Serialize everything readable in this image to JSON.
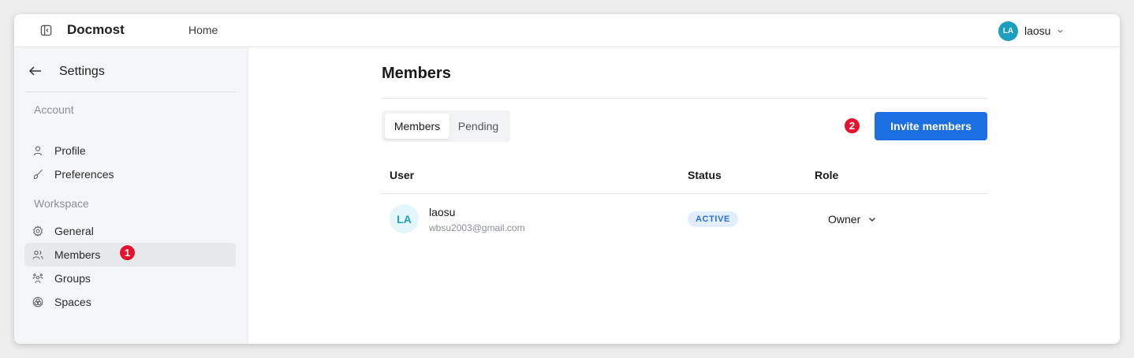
{
  "header": {
    "app_name": "Docmost",
    "home_link": "Home",
    "user": {
      "initials": "LA",
      "name": "laosu"
    }
  },
  "sidebar": {
    "title": "Settings",
    "sections": [
      {
        "label": "Account",
        "items": [
          {
            "label": "Profile",
            "icon": "user-icon"
          },
          {
            "label": "Preferences",
            "icon": "brush-icon"
          }
        ]
      },
      {
        "label": "Workspace",
        "items": [
          {
            "label": "General",
            "icon": "gear-icon"
          },
          {
            "label": "Members",
            "icon": "users-icon",
            "active": true
          },
          {
            "label": "Groups",
            "icon": "group-icon"
          },
          {
            "label": "Spaces",
            "icon": "spaces-icon"
          }
        ]
      }
    ]
  },
  "annotations": {
    "marker1": "1",
    "marker2": "2"
  },
  "main": {
    "title": "Members",
    "tabs": [
      {
        "label": "Members",
        "active": true
      },
      {
        "label": "Pending",
        "active": false
      }
    ],
    "invite_button": "Invite members",
    "table": {
      "columns": [
        "User",
        "Status",
        "Role"
      ],
      "rows": [
        {
          "initials": "LA",
          "name": "laosu",
          "email": "wbsu2003@gmail.com",
          "status": "ACTIVE",
          "role": "Owner"
        }
      ]
    }
  },
  "colors": {
    "accent": "#1c6fe0",
    "avatar": "#1a9fbf",
    "marker": "#e8112d",
    "sidebar_bg": "#f4f5f7"
  }
}
